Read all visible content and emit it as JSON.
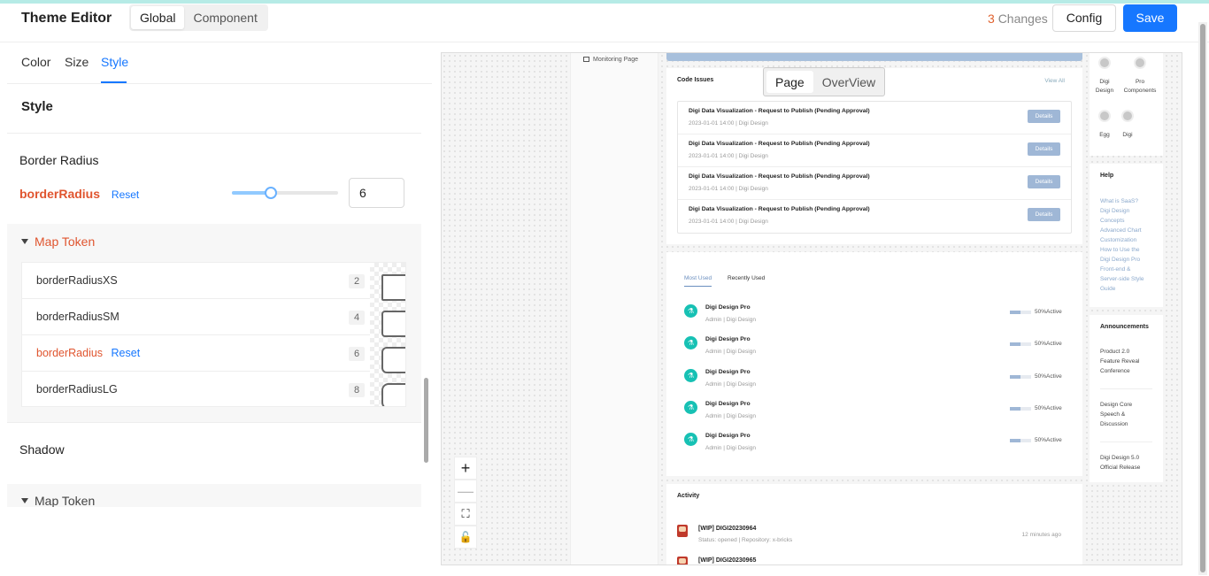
{
  "header": {
    "title": "Theme Editor",
    "modes": [
      "Global",
      "Component"
    ],
    "changes_count": "3",
    "changes_label": "Changes",
    "config_label": "Config",
    "save_label": "Save"
  },
  "tabs": [
    "Color",
    "Size",
    "Style"
  ],
  "active_tab": "Style",
  "style_section": {
    "title": "Style",
    "border_radius": {
      "section_title": "Border Radius",
      "token_name": "borderRadius",
      "reset_label": "Reset",
      "value": "6",
      "slider_fraction": 0.37
    },
    "map_token_label": "Map Token",
    "map_tokens": [
      {
        "name": "borderRadiusXS",
        "value": "2",
        "modified": false
      },
      {
        "name": "borderRadiusSM",
        "value": "4",
        "modified": false
      },
      {
        "name": "borderRadius",
        "value": "6",
        "modified": true,
        "reset_label": "Reset"
      },
      {
        "name": "borderRadiusLG",
        "value": "8",
        "modified": false
      }
    ],
    "shadow_title": "Shadow",
    "shadow_map_token_label": "Map Token"
  },
  "preview": {
    "sidebar_item": "Monitoring Page",
    "view_switch": [
      "Page",
      "OverView"
    ],
    "code_issues": {
      "title": "Code Issues",
      "view_all": "View All",
      "items": [
        {
          "title": "Digi Data Visualization - Request to Publish (Pending Approval)",
          "meta": "2023-01-01 14:00 | Digi Design",
          "action": "Details"
        },
        {
          "title": "Digi Data Visualization - Request to Publish (Pending Approval)",
          "meta": "2023-01-01 14:00 | Digi Design",
          "action": "Details"
        },
        {
          "title": "Digi Data Visualization - Request to Publish (Pending Approval)",
          "meta": "2023-01-01 14:00 | Digi Design",
          "action": "Details"
        },
        {
          "title": "Digi Data Visualization - Request to Publish (Pending Approval)",
          "meta": "2023-01-01 14:00 | Digi Design",
          "action": "Details"
        }
      ]
    },
    "usage": {
      "tabs": [
        "Most Used",
        "Recently Used"
      ],
      "items": [
        {
          "title": "Digi Design Pro",
          "meta": "Admin | Digi Design",
          "status": "50%Active",
          "progress": 0.5
        },
        {
          "title": "Digi Design Pro",
          "meta": "Admin | Digi Design",
          "status": "50%Active",
          "progress": 0.5
        },
        {
          "title": "Digi Design Pro",
          "meta": "Admin | Digi Design",
          "status": "50%Active",
          "progress": 0.5
        },
        {
          "title": "Digi Design Pro",
          "meta": "Admin | Digi Design",
          "status": "50%Active",
          "progress": 0.5
        },
        {
          "title": "Digi Design Pro",
          "meta": "Admin | Digi Design",
          "status": "50%Active",
          "progress": 0.5
        }
      ]
    },
    "activity": {
      "title": "Activity",
      "items": [
        {
          "title": "[WIP] DIGI20230964",
          "meta": "Status: opened | Repository: x-bricks",
          "time": "12 minutes ago"
        },
        {
          "title": "[WIP] DIGI20230965",
          "meta": "",
          "time": ""
        }
      ]
    },
    "shortcuts": [
      {
        "line1": "Digi",
        "line2": "Design"
      },
      {
        "line1": "Pro",
        "line2": "Components"
      },
      {
        "line1": "Egg",
        "line2": ""
      },
      {
        "line1": "Digi",
        "line2": ""
      }
    ],
    "help": {
      "title": "Help",
      "links": [
        "What is SaaS?",
        "Digi Design",
        "Concepts",
        "Advanced Chart",
        "Customization",
        "How to Use the",
        "Digi Design Pro",
        "Front-end &",
        "Server-side Style",
        "Guide"
      ]
    },
    "announcements": {
      "title": "Announcements",
      "items": [
        [
          "Product 2.0",
          "Feature Reveal",
          "Conference"
        ],
        [
          "Design Core",
          "Speech &",
          "Discussion"
        ],
        [
          "Digi Design 5.0",
          "Official Release"
        ]
      ]
    },
    "controls": [
      "+",
      "—",
      "⛶",
      "🔓"
    ]
  },
  "colors": {
    "accent": "#1677ff",
    "modified_token": "#e0552f",
    "changes_count": "#e0622f"
  }
}
